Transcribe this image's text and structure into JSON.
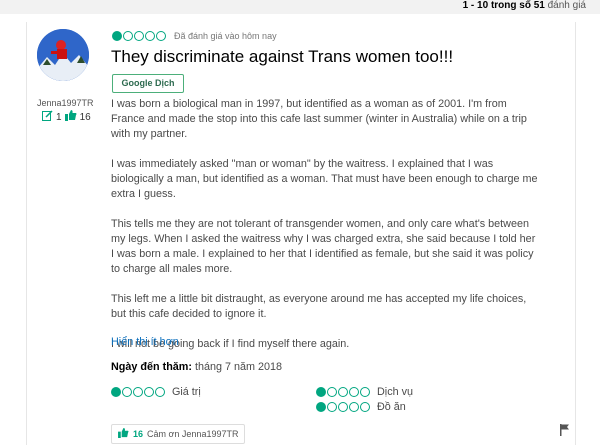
{
  "pager": {
    "prefix": "1 - 10 trong số ",
    "count": "51",
    "suffix": " đánh giá"
  },
  "reviewer": {
    "username": "Jenna1997TR",
    "reviews": "1",
    "helpful": "16"
  },
  "review": {
    "rating": 1,
    "date": "Đã đánh giá vào hôm nay",
    "title": "They discriminate against Trans women too!!!",
    "translate_label": "Google Dịch",
    "paragraphs": [
      "I was born a biological man in 1997, but identified as a woman as of 2001. I'm from France and made the stop into this cafe last summer (winter in Australia) while on a trip with my partner.",
      "I was immediately asked \"man or woman\" by the waitress. I explained that I was biologically a man, but identified as a woman. That must have been enough to charge me extra I guess.",
      "This tells me they are not tolerant of transgender women, and only care what's between my legs. When I asked the waitress why I was charged extra, she said because I told her I was born a male. I explained to her that I identified as female, but she said it was policy to charge all males more.",
      "This left me a little bit distraught, as everyone around me has accepted my life choices, but this cafe decided to ignore it.",
      "I will not be going back if I find myself there again."
    ],
    "more_label": "Hiển thị ít hơn",
    "visit_label": "Ngày đến thăm:",
    "visit_date": "tháng 7 năm 2018",
    "subratings": [
      {
        "label": "Giá trị",
        "rating": 1
      },
      {
        "label": "Dịch vụ",
        "rating": 1
      },
      {
        "label": "Đồ ăn",
        "rating": 1
      }
    ],
    "thanks_count": "16",
    "thanks_label": "Cảm ơn Jenna1997TR"
  },
  "colors": {
    "accent": "#00a680",
    "link": "#0b6fbd"
  }
}
